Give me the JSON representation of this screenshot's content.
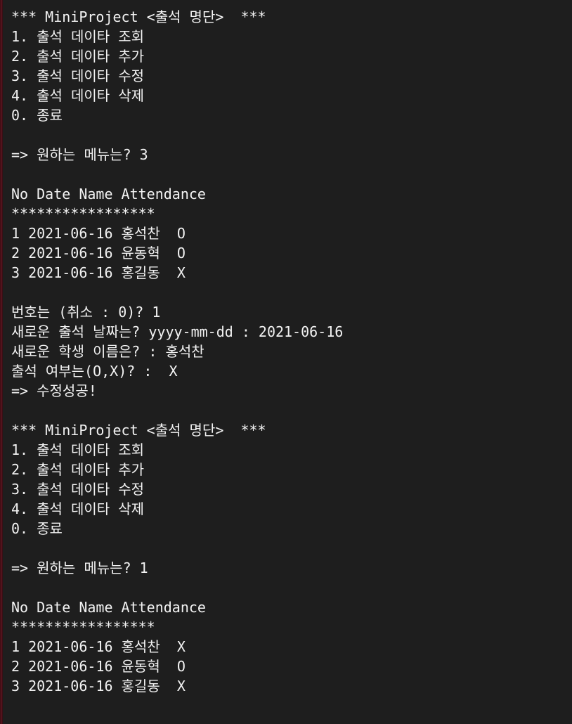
{
  "terminal": {
    "lines": [
      "*** MiniProject <출석 명단>  ***",
      "1. 출석 데이타 조회",
      "2. 출석 데이타 추가",
      "3. 출석 데이타 수정",
      "4. 출석 데이타 삭제",
      "0. 종료",
      "",
      "=> 원하는 메뉴는? 3",
      "",
      "No Date Name Attendance",
      "*****************",
      "1 2021-06-16 홍석찬  O",
      "2 2021-06-16 윤동혁  O",
      "3 2021-06-16 홍길동  X",
      "",
      "번호는 (취소 : 0)? 1",
      "새로운 출석 날짜는? yyyy-mm-dd : 2021-06-16",
      "새로운 학생 이름은? : 홍석찬",
      "출석 여부는(O,X)? :  X",
      "=> 수정성공!",
      "",
      "*** MiniProject <출석 명단>  ***",
      "1. 출석 데이타 조회",
      "2. 출석 데이타 추가",
      "3. 출석 데이타 수정",
      "4. 출석 데이타 삭제",
      "0. 종료",
      "",
      "=> 원하는 메뉴는? 1",
      "",
      "No Date Name Attendance",
      "*****************",
      "1 2021-06-16 홍석찬  X",
      "2 2021-06-16 윤동혁  O",
      "3 2021-06-16 홍길동  X"
    ]
  },
  "colors": {
    "background": "#1e1e1e",
    "text": "#f2f2f2",
    "edge": "#5c1620"
  }
}
